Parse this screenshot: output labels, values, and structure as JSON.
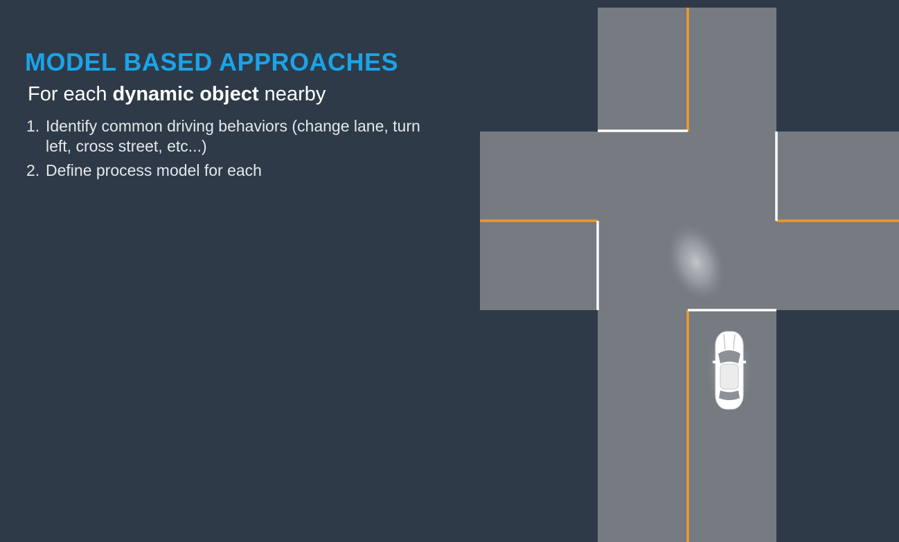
{
  "slide": {
    "title": "MODEL BASED APPROACHES",
    "subtitle_prefix": "For each ",
    "subtitle_emphasis": "dynamic object",
    "subtitle_suffix": " nearby",
    "steps": [
      {
        "number": "1.",
        "text": "Identify common driving behaviors (change lane, turn left, cross street, etc...)"
      },
      {
        "number": "2.",
        "text": "Define process model for each"
      }
    ]
  },
  "colors": {
    "background": "#2e3a47",
    "road": "#767a81",
    "title_accent": "#1aa3e8",
    "center_line": "#f0982c",
    "stop_line": "#ffffff",
    "car_body": "#ffffff",
    "uncertainty_blob": "#b5b8bd"
  },
  "icons": [
    "car-icon",
    "uncertainty-ellipse"
  ]
}
